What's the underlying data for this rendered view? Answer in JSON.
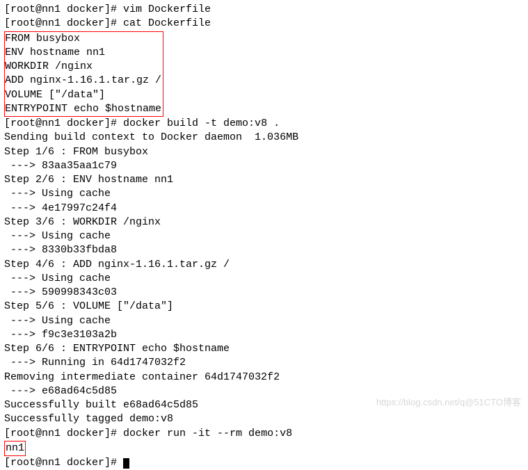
{
  "prompt1": "[root@nn1 docker]# ",
  "cmd_vim": "vim Dockerfile",
  "cmd_cat": "cat Dockerfile",
  "dockerfile": {
    "l1": "FROM busybox",
    "l2": "ENV hostname nn1",
    "l3": "WORKDIR /nginx",
    "l4": "ADD nginx-1.16.1.tar.gz /",
    "l5": "VOLUME [\"/data\"]",
    "l6": "ENTRYPOINT echo $hostname"
  },
  "cmd_build": "docker build -t demo:v8 .",
  "build": {
    "send": "Sending build context to Docker daemon  1.036MB",
    "s1": "Step 1/6 : FROM busybox",
    "s1a": " ---> 83aa35aa1c79",
    "s2": "Step 2/6 : ENV hostname nn1",
    "s2a": " ---> Using cache",
    "s2b": " ---> 4e17997c24f4",
    "s3": "Step 3/6 : WORKDIR /nginx",
    "s3a": " ---> Using cache",
    "s3b": " ---> 8330b33fbda8",
    "s4": "Step 4/6 : ADD nginx-1.16.1.tar.gz /",
    "s4a": " ---> Using cache",
    "s4b": " ---> 590998343c03",
    "s5": "Step 5/6 : VOLUME [\"/data\"]",
    "s5a": " ---> Using cache",
    "s5b": " ---> f9c3e3103a2b",
    "s6": "Step 6/6 : ENTRYPOINT echo $hostname",
    "s6a": " ---> Running in 64d1747032f2",
    "rem": "Removing intermediate container 64d1747032f2",
    "s6b": " ---> e68ad64c5d85",
    "ok1": "Successfully built e68ad64c5d85",
    "ok2": "Successfully tagged demo:v8"
  },
  "cmd_run": "docker run -it --rm demo:v8",
  "output_nn1": "nn1",
  "watermark": "https://blog.csdn.net/q@51CTO博客"
}
